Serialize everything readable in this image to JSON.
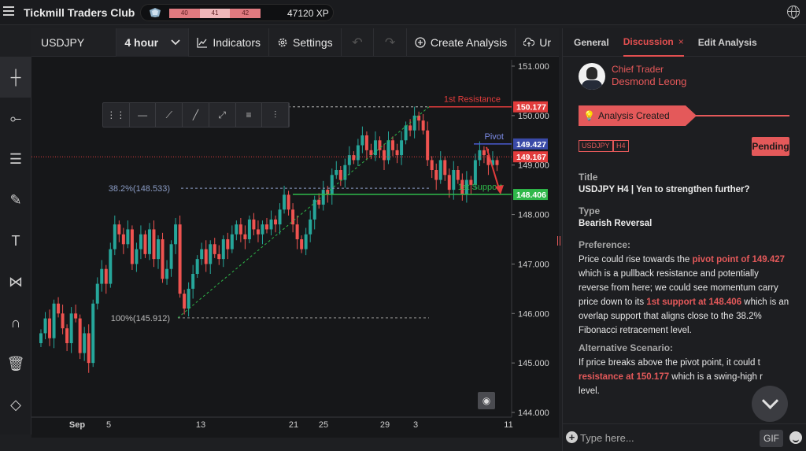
{
  "topbar": {
    "title": "Tickmill Traders Club",
    "levels": [
      "40",
      "41",
      "42"
    ],
    "xp": "47120 XP"
  },
  "toolbar": {
    "symbol": "USDJPY",
    "interval": "4 hour",
    "indicators": "Indicators",
    "settings": "Settings",
    "create_analysis": "Create Analysis",
    "unpublish_partial": "Ur"
  },
  "left_tools": [
    "crosshair-icon",
    "line-tool-icon",
    "fib-tool-icon",
    "brush-icon",
    "text-tool-icon",
    "pattern-icon",
    "magnet-icon",
    "trash-icon",
    "layers-icon"
  ],
  "chart_data": {
    "type": "candlestick",
    "symbol": "USDJPY",
    "timeframe": "4 hour",
    "y_ticks": [
      "151.000",
      "150.000",
      "149.000",
      "148.000",
      "147.000",
      "146.000",
      "145.000",
      "144.000"
    ],
    "ylim": [
      144.0,
      151.0
    ],
    "x_ticks": [
      "Sep",
      "5",
      "13",
      "21",
      "25",
      "29",
      "3",
      "11"
    ],
    "price_labels": [
      {
        "label": "150.177",
        "value": 150.177,
        "color": "#e23c3c"
      },
      {
        "label": "149.427",
        "value": 149.427,
        "color": "#3a4aa8"
      },
      {
        "label": "149.167",
        "value": 149.167,
        "color": "#e23c3c"
      },
      {
        "label": "148.406",
        "value": 148.406,
        "color": "#2fb84a"
      }
    ],
    "annotations": {
      "resistance": "1st Resistance",
      "pivot": "Pivot",
      "support": "1st Support",
      "fib_38": "38.2%(148.533)",
      "fib_100": "100%(145.912)"
    },
    "levels": {
      "resistance": 150.177,
      "pivot": 149.427,
      "current": 149.167,
      "support": 148.406,
      "fib_38": 148.533,
      "fib_100": 145.912
    },
    "colors": {
      "up": "#26a69a",
      "down": "#ef5350",
      "resistance": "#e23c3c",
      "support": "#2fb84a",
      "pivot": "#4a5bd0"
    },
    "closes": [
      145.6,
      145.9,
      145.5,
      146.2,
      146.0,
      145.7,
      145.4,
      146.0,
      145.9,
      145.2,
      145.6,
      145.0,
      146.2,
      146.6,
      146.9,
      146.6,
      147.3,
      147.8,
      147.6,
      147.4,
      147.7,
      147.0,
      147.3,
      147.6,
      147.2,
      147.7,
      147.1,
      147.5,
      146.7,
      146.9,
      147.4,
      147.8,
      146.4,
      146.1,
      146.5,
      146.8,
      147.1,
      147.3,
      147.0,
      147.4,
      147.2,
      147.1,
      147.5,
      147.3,
      147.6,
      147.8,
      147.6,
      147.5,
      147.9,
      147.7,
      147.6,
      147.8,
      147.7,
      147.9,
      147.8,
      148.1,
      148.4,
      148.1,
      147.8,
      147.5,
      147.3,
      147.6,
      147.9,
      148.3,
      148.2,
      148.5,
      148.4,
      148.8,
      148.9,
      148.7,
      149.0,
      149.2,
      149.1,
      149.4,
      149.6,
      149.3,
      149.2,
      149.5,
      149.3,
      149.1,
      149.5,
      149.3,
      149.2,
      149.5,
      149.8,
      149.7,
      150.0,
      149.9,
      149.7,
      149.1,
      148.9,
      148.7,
      149.1,
      148.8,
      148.5,
      148.9,
      148.7,
      148.4,
      148.7,
      148.6,
      149.1,
      149.3,
      149.2,
      149.0,
      149.1,
      149.0
    ]
  },
  "panel": {
    "tabs": [
      "General",
      "Discussion",
      "Edit Analysis"
    ],
    "active_tab": "Discussion",
    "author_role": "Chief Trader",
    "author_name": "Desmond Leong",
    "created": "Analysis Created",
    "tags": [
      "USDJPY",
      "H4"
    ],
    "status": "Pending",
    "title_label": "Title",
    "title_value": "USDJPY H4 | Yen to strengthen further?",
    "type_label": "Type",
    "type_value": "Bearish Reversal",
    "pref_label": "Preference:",
    "pref_p1": "Price could rise towards the ",
    "pref_h1": "pivot point of 149.427",
    "pref_p2": " which is a pullback resistance and potentially reverse from here; we could see momentum carry price down to its ",
    "pref_h2": "1st support at 148.406",
    "pref_p3": " which is an overlap support that aligns close to the 38.2% Fibonacci retracement level.",
    "alt_label": "Alternative Scenario:",
    "alt_p1": "If price breaks above the pivot point, it could t",
    "alt_h1": "resistance at 150.177",
    "alt_p2": " which is a swing-high r",
    "alt_p3": "level.",
    "chat_placeholder": "Type here...",
    "gif": "GIF"
  }
}
